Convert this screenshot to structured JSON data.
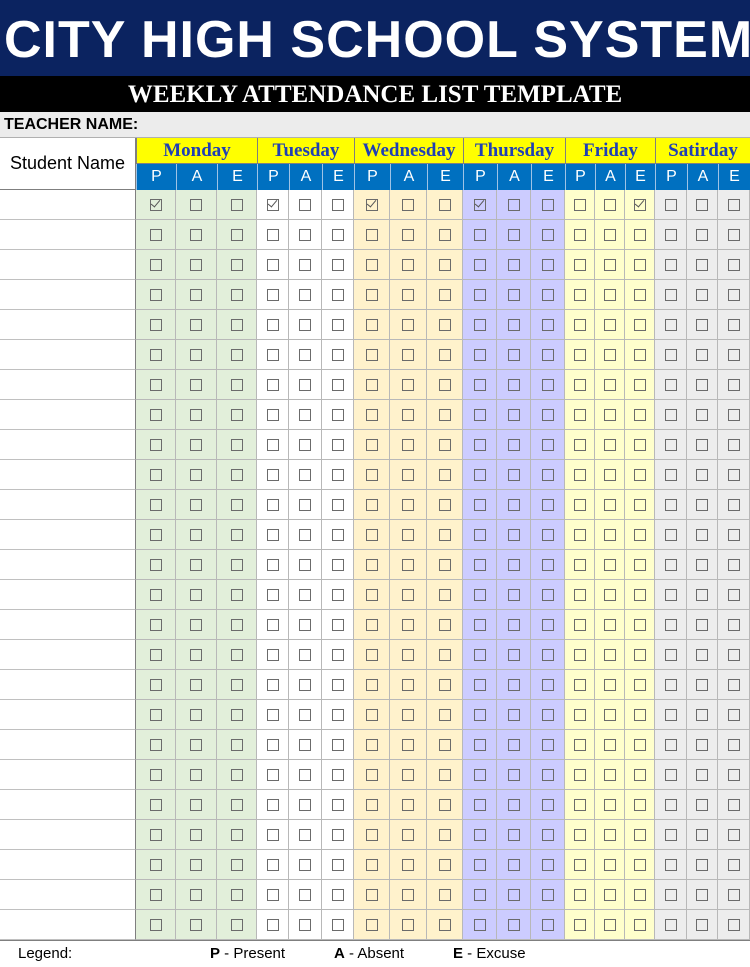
{
  "title": "CITY HIGH SCHOOL SYSTEM",
  "subtitle": "WEEKLY ATTENDANCE LIST TEMPLATE",
  "teacher_label": "TEACHER NAME:",
  "student_name_header": "Student Name",
  "days": [
    {
      "name": "Monday",
      "color": "#e2efda"
    },
    {
      "name": "Tuesday",
      "color": "#ffffff"
    },
    {
      "name": "Wednesday",
      "color": "#fff2cc"
    },
    {
      "name": "Thursday",
      "color": "#ccccff"
    },
    {
      "name": "Friday",
      "color": "#ffffcc"
    },
    {
      "name": "Satirday",
      "color": "#ededed"
    }
  ],
  "sub_columns": [
    "P",
    "A",
    "E"
  ],
  "row_count": 25,
  "checked": [
    {
      "row": 0,
      "day": 0,
      "col": 0
    },
    {
      "row": 0,
      "day": 1,
      "col": 0
    },
    {
      "row": 0,
      "day": 2,
      "col": 0
    },
    {
      "row": 0,
      "day": 3,
      "col": 0
    },
    {
      "row": 0,
      "day": 4,
      "col": 2
    }
  ],
  "legend": {
    "label": "Legend:",
    "p_key": "P",
    "p_text": " - Present",
    "a_key": "A",
    "a_text": " - Absent",
    "e_key": "E",
    "e_text": " - Excuse"
  },
  "colors": {
    "title_bg": "#0b2360",
    "day_header_bg": "#ffff00",
    "day_header_text": "#1f3fb5",
    "sub_header_bg": "#0070c0"
  }
}
